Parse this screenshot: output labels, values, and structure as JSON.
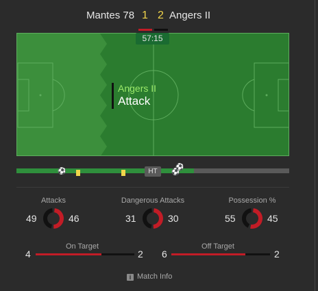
{
  "match": {
    "home_team": "Mantes 78",
    "away_team": "Angers II",
    "home_score": "1",
    "away_score": "2",
    "clock": "57:15"
  },
  "colors": {
    "home": "#c21c26",
    "away": "#111111",
    "pitch": "#3c8f3c",
    "highlight_team": "#9bea6a"
  },
  "live_event": {
    "team": "Angers II",
    "type": "Attack"
  },
  "timeline": {
    "half_time_label": "HT",
    "progress_percent": 65,
    "icons": [
      "goal-ball-icon",
      "yellow-card-icon",
      "yellow-card-icon",
      "goal-ball-icon",
      "goal-ball-icon"
    ]
  },
  "stats": {
    "attacks": {
      "label": "Attacks",
      "home": "49",
      "away": "46"
    },
    "dangerous_attacks": {
      "label": "Dangerous Attacks",
      "home": "31",
      "away": "30"
    },
    "possession": {
      "label": "Possession %",
      "home": "55",
      "away": "45"
    },
    "on_target": {
      "label": "On Target",
      "home": "4",
      "away": "2"
    },
    "off_target": {
      "label": "Off Target",
      "home": "6",
      "away": "2"
    }
  },
  "footer": {
    "match_info_label": "Match Info",
    "info_icon": "info-icon"
  }
}
